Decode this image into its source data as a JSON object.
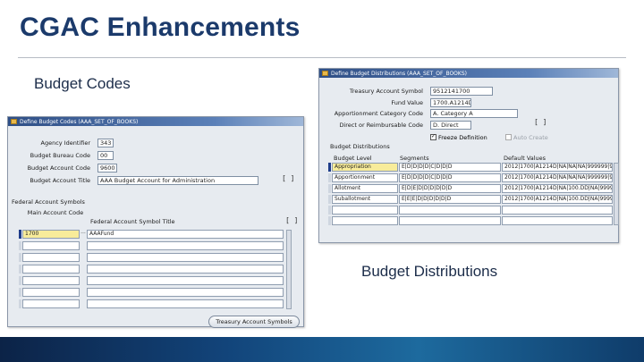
{
  "slide": {
    "title": "CGAC Enhancements",
    "caption_codes": "Budget Codes",
    "caption_distributions": "Budget Distributions"
  },
  "codes_window": {
    "title": "Define Budget Codes (AAA_SET_OF_BOOKS)",
    "fields": [
      {
        "label": "Agency Identifier",
        "value": "343"
      },
      {
        "label": "Budget Bureau Code",
        "value": "00"
      },
      {
        "label": "Budget Account Code",
        "value": "9600"
      },
      {
        "label": "Budget Account Title",
        "value": "AAA Budget Account for Administration"
      }
    ],
    "section_label": "Federal Account Symbols",
    "columns": [
      "Main Account Code",
      "Federal Account Symbol Title"
    ],
    "rows": [
      {
        "main_code": "1700",
        "title": "AAAFund"
      }
    ],
    "empty_rows": 6,
    "button_label": "Treasury Account Symbols"
  },
  "dist_window": {
    "title": "Define Budget Distributions (AAA_SET_OF_BOOKS)",
    "fields": [
      {
        "label": "Treasury Account Symbol",
        "value": "9512141700"
      },
      {
        "label": "Fund Value",
        "value": "1700.A1214D"
      },
      {
        "label": "Apportionment Category Code",
        "value": "A. Category A"
      },
      {
        "label": "Direct or Reimbursable Code",
        "value": "D. Direct"
      }
    ],
    "checkbox_freeze": {
      "label": "Freeze Definition",
      "checked": true
    },
    "checkbox_auto": {
      "label": "Auto Create",
      "checked": false
    },
    "section_label": "Budget Distributions",
    "columns": [
      "Budget Level",
      "Segments",
      "Default Values"
    ],
    "rows": [
      {
        "level": "Appropriation",
        "segments": "E|D|D|D|D|C|D|D|D",
        "defaults": "2012|1700|A1214D|NA|NA|NA|999999|9999"
      },
      {
        "level": "Apportionment",
        "segments": "E|D|D|D|D|C|D|D|D",
        "defaults": "2012|1700|A1214D|NA|NA|NA|999999|9999"
      },
      {
        "level": "Allotment",
        "segments": "E|D|E|D|D|D|D|D|D",
        "defaults": "2012|1700|A1214D|NA|100.DD|NA|999999"
      },
      {
        "level": "Suballotment",
        "segments": "E|E|E|D|D|D|D|D|D",
        "defaults": "2012|1700|A1214D|NA|100.DD|NA|999999"
      }
    ],
    "empty_rows": 2
  }
}
